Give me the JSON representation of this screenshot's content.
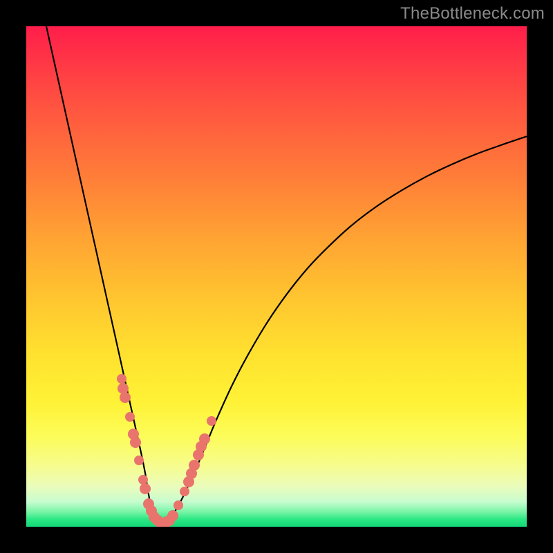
{
  "watermark": {
    "text": "TheBottleneck.com"
  },
  "chart_data": {
    "type": "line",
    "title": "",
    "xlabel": "",
    "ylabel": "",
    "xlim": [
      0,
      100
    ],
    "ylim": [
      0,
      100
    ],
    "grid": false,
    "series": [
      {
        "name": "bottleneck-curve",
        "x": [
          4,
          5,
          6,
          7,
          8,
          9,
          10,
          11,
          12,
          13,
          14,
          15,
          16,
          17,
          18,
          19,
          20,
          21,
          22,
          23,
          23.8,
          24.2,
          24.6,
          25,
          25.5,
          26,
          26.5,
          27,
          27.6,
          28.4,
          29.4,
          30.6,
          32,
          34,
          36,
          38,
          41,
          44,
          48,
          52,
          56,
          60,
          65,
          70,
          75,
          80,
          85,
          90,
          95,
          100
        ],
        "y": [
          100,
          95.5,
          91,
          86.5,
          82,
          77.5,
          73,
          68.5,
          64,
          59.5,
          55,
          50.5,
          46,
          41.5,
          37,
          32.5,
          28,
          23.5,
          19,
          14.5,
          10.5,
          7.9,
          5.6,
          3.7,
          2.2,
          1.2,
          0.6,
          0.4,
          0.6,
          1.3,
          2.6,
          4.6,
          7.4,
          11.8,
          16.6,
          21.4,
          28,
          33.8,
          40.6,
          46.4,
          51.4,
          55.6,
          60.2,
          64,
          67.2,
          70,
          72.4,
          74.5,
          76.3,
          78
        ]
      }
    ],
    "points": [
      {
        "x": 19.0,
        "y": 29.5,
        "r": 7
      },
      {
        "x": 19.4,
        "y": 27.6,
        "r": 8
      },
      {
        "x": 19.8,
        "y": 25.8,
        "r": 8
      },
      {
        "x": 20.7,
        "y": 22.0,
        "r": 7
      },
      {
        "x": 21.4,
        "y": 18.5,
        "r": 8
      },
      {
        "x": 21.8,
        "y": 16.8,
        "r": 8
      },
      {
        "x": 22.5,
        "y": 13.3,
        "r": 7
      },
      {
        "x": 23.4,
        "y": 9.4,
        "r": 7
      },
      {
        "x": 23.8,
        "y": 7.6,
        "r": 8
      },
      {
        "x": 24.5,
        "y": 4.6,
        "r": 8
      },
      {
        "x": 25.0,
        "y": 3.2,
        "r": 8
      },
      {
        "x": 25.6,
        "y": 2.0,
        "r": 8
      },
      {
        "x": 26.2,
        "y": 1.2,
        "r": 8
      },
      {
        "x": 26.8,
        "y": 0.8,
        "r": 8
      },
      {
        "x": 27.4,
        "y": 0.7,
        "r": 8
      },
      {
        "x": 28.0,
        "y": 0.9,
        "r": 8
      },
      {
        "x": 28.6,
        "y": 1.3,
        "r": 8
      },
      {
        "x": 29.3,
        "y": 2.2,
        "r": 8
      },
      {
        "x": 30.4,
        "y": 4.3,
        "r": 7
      },
      {
        "x": 31.6,
        "y": 7.0,
        "r": 7
      },
      {
        "x": 32.4,
        "y": 9.0,
        "r": 8
      },
      {
        "x": 33.0,
        "y": 10.7,
        "r": 8
      },
      {
        "x": 33.6,
        "y": 12.3,
        "r": 8
      },
      {
        "x": 34.4,
        "y": 14.4,
        "r": 8
      },
      {
        "x": 35.0,
        "y": 16.0,
        "r": 8
      },
      {
        "x": 35.6,
        "y": 17.6,
        "r": 8
      },
      {
        "x": 37.0,
        "y": 21.2,
        "r": 7
      }
    ],
    "background_gradient": {
      "stops": [
        {
          "pos": 0,
          "color": "#ff1d4a"
        },
        {
          "pos": 8,
          "color": "#ff3a45"
        },
        {
          "pos": 18,
          "color": "#ff5a3f"
        },
        {
          "pos": 30,
          "color": "#ff7d38"
        },
        {
          "pos": 42,
          "color": "#ffa233"
        },
        {
          "pos": 55,
          "color": "#ffc72f"
        },
        {
          "pos": 66,
          "color": "#ffe22f"
        },
        {
          "pos": 75,
          "color": "#fff236"
        },
        {
          "pos": 82,
          "color": "#fcfc5a"
        },
        {
          "pos": 88,
          "color": "#f6fc8f"
        },
        {
          "pos": 92,
          "color": "#eafcbc"
        },
        {
          "pos": 95,
          "color": "#c7fccf"
        },
        {
          "pos": 97,
          "color": "#7af5a7"
        },
        {
          "pos": 98.5,
          "color": "#2be884"
        },
        {
          "pos": 100,
          "color": "#14d877"
        }
      ]
    },
    "colors": {
      "curve": "#000000",
      "points": "#e9746d",
      "frame": "#000000"
    }
  }
}
